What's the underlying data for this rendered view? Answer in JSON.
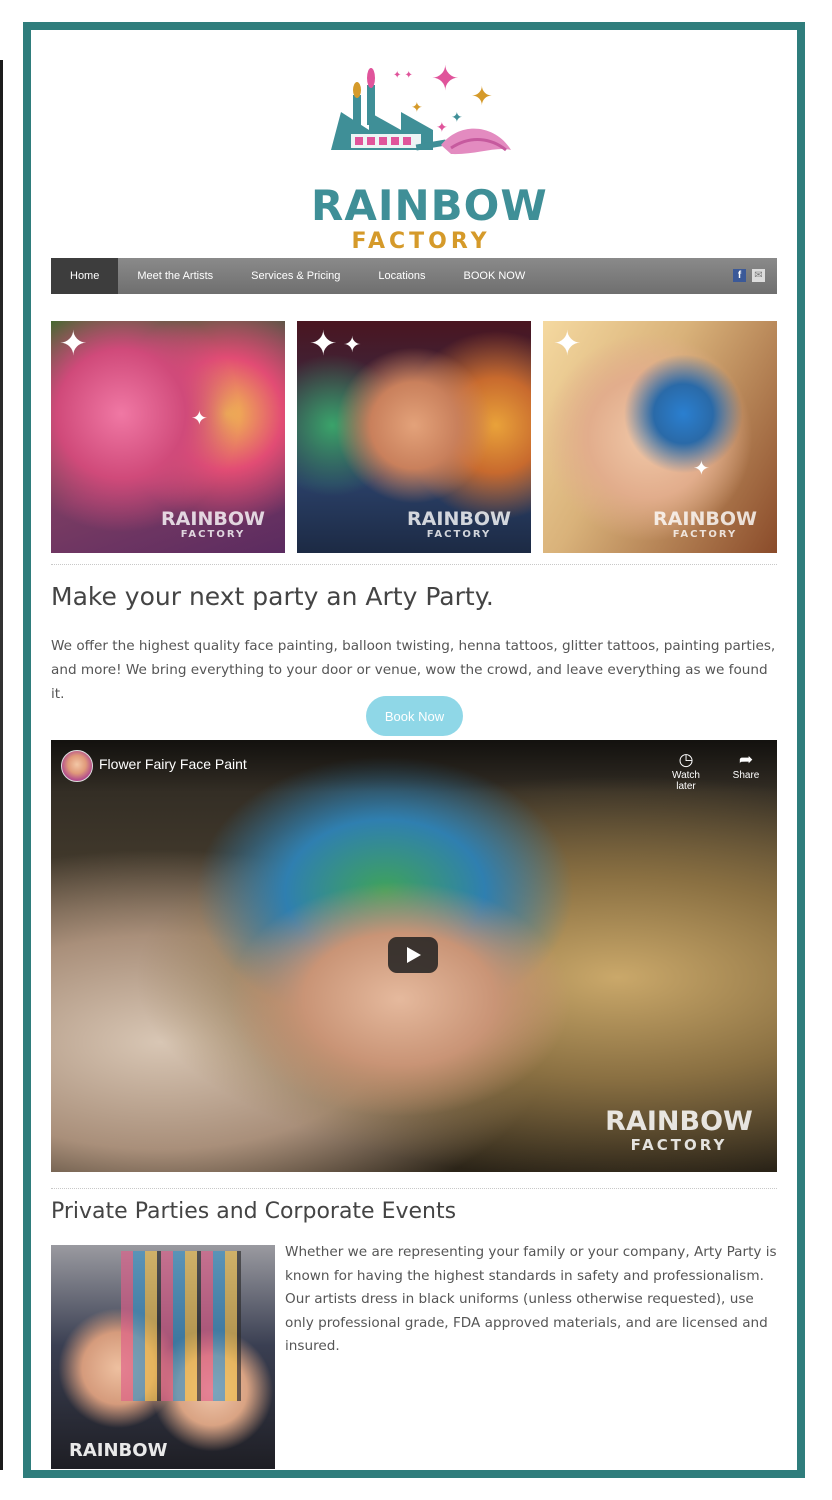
{
  "brand": {
    "name_line1": "RAINBOW",
    "name_line2": "FACTORY",
    "colors": {
      "teal": "#3f8f97",
      "gold": "#d59a2a",
      "pink": "#e0549b",
      "frame": "#2f7d7c"
    }
  },
  "nav": {
    "items": [
      {
        "label": "Home",
        "active": true
      },
      {
        "label": "Meet the Artists"
      },
      {
        "label": "Services & Pricing"
      },
      {
        "label": "Locations"
      },
      {
        "label": "BOOK NOW"
      }
    ],
    "icons": [
      "facebook-icon",
      "email-icon"
    ],
    "facebook_glyph": "f",
    "email_glyph": "✉"
  },
  "gallery": {
    "watermark_line1": "RAINBOW",
    "watermark_line2": "FACTORY"
  },
  "intro": {
    "heading": "Make your next party an Arty Party.",
    "body": "We offer the highest quality face painting, balloon twisting, henna tattoos, glitter tattoos, painting parties, and more! We bring everything to your door or venue, wow the crowd, and leave everything as we found it.",
    "button": "Book Now"
  },
  "video": {
    "title": "Flower Fairy Face Paint",
    "watch_later": "Watch later",
    "share": "Share",
    "watermark_line1": "RAINBOW",
    "watermark_line2": "FACTORY"
  },
  "private": {
    "heading": "Private Parties and Corporate Events",
    "body": "Whether we are representing your family or your company, Arty Party is known for having the highest standards in safety and professionalism. Our artists dress in black uniforms (unless otherwise requested), use only professional grade, FDA approved materials, and are licensed and insured.",
    "photo_text": "RAINBOW"
  }
}
